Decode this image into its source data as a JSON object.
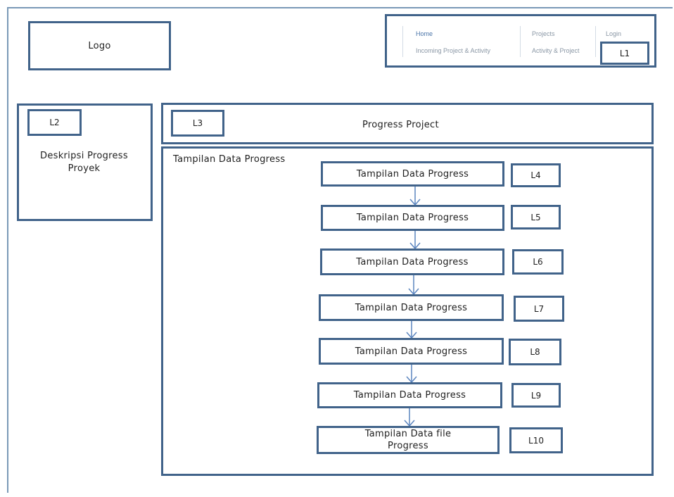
{
  "header": {
    "logo_label": "Logo",
    "nav": {
      "home": "Home",
      "incoming": "Incoming Project & Activity",
      "projects": "Projects",
      "activity_project": "Activity & Project",
      "login": "Login",
      "tag": "L1"
    }
  },
  "sidebar": {
    "tag": "L2",
    "description": "Deskripsi Progress Proyek"
  },
  "title_bar": {
    "tag": "L3",
    "title": "Progress Project"
  },
  "content": {
    "heading": "Tampilan Data Progress",
    "steps": [
      {
        "label": "Tampilan Data Progress",
        "tag": "L4"
      },
      {
        "label": "Tampilan Data Progress",
        "tag": "L5"
      },
      {
        "label": "Tampilan Data Progress",
        "tag": "L6"
      },
      {
        "label": "Tampilan Data Progress",
        "tag": "L7"
      },
      {
        "label": "Tampilan Data Progress",
        "tag": "L8"
      },
      {
        "label": "Tampilan Data Progress",
        "tag": "L9"
      },
      {
        "label": "Tampilan Data file Progress",
        "tag": "L10"
      }
    ]
  },
  "colors": {
    "box_border": "#41638a",
    "arrow": "#5b85bf",
    "nav_active": "#4a74a8",
    "nav_text": "#8a97a5"
  }
}
